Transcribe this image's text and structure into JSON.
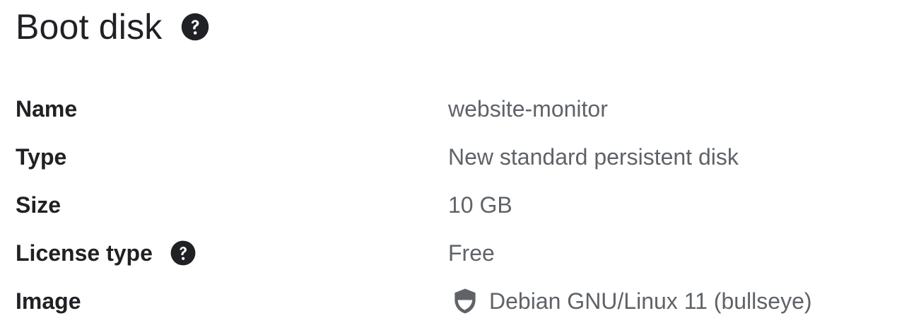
{
  "section": {
    "title": "Boot disk",
    "title_help_icon": "help-circle-icon"
  },
  "details": [
    {
      "label": "Name",
      "value": "website-monitor"
    },
    {
      "label": "Type",
      "value": "New standard persistent disk"
    },
    {
      "label": "Size",
      "value": "10 GB"
    },
    {
      "label": "License type",
      "value": "Free",
      "help_icon": "help-circle-icon"
    },
    {
      "label": "Image",
      "value": "Debian GNU/Linux 11 (bullseye)",
      "value_icon": "shield-icon"
    }
  ],
  "colors": {
    "text_primary": "#202124",
    "text_secondary": "#5f6368",
    "icon": "#202124"
  }
}
